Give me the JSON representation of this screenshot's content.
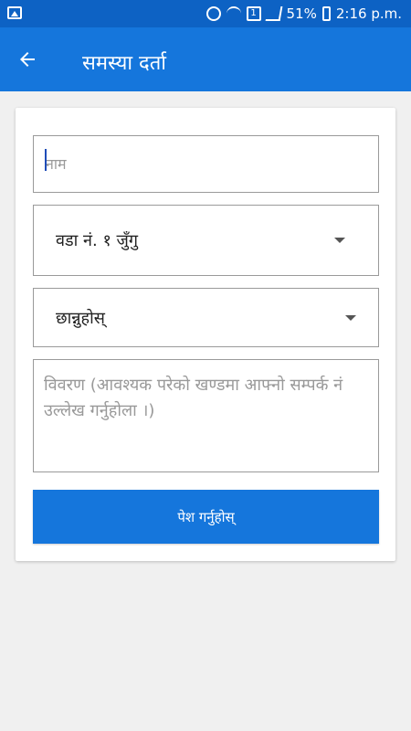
{
  "status_bar": {
    "battery_percent": "51%",
    "time": "2:16 p.m.",
    "icons": [
      "image-icon",
      "alarm-icon",
      "wifi-icon",
      "sim-icon",
      "signal-icon",
      "battery-icon"
    ]
  },
  "app_bar": {
    "title": "समस्या दर्ता",
    "back_icon": "arrow-left-icon"
  },
  "form": {
    "name_placeholder": "नाम",
    "ward_value": "वडा नं. १  जुँगु",
    "choose_value": "छान्नुहोस्",
    "description_placeholder": "विवरण (आवश्यक परेको खण्डमा आफ्नो सम्पर्क नं उल्लेख गर्नुहोला ।)",
    "submit_label": "पेश गर्नुहोस्"
  },
  "colors": {
    "primary": "#1576dc",
    "status_bar": "#0d62c4",
    "background": "#f0f0f0"
  }
}
